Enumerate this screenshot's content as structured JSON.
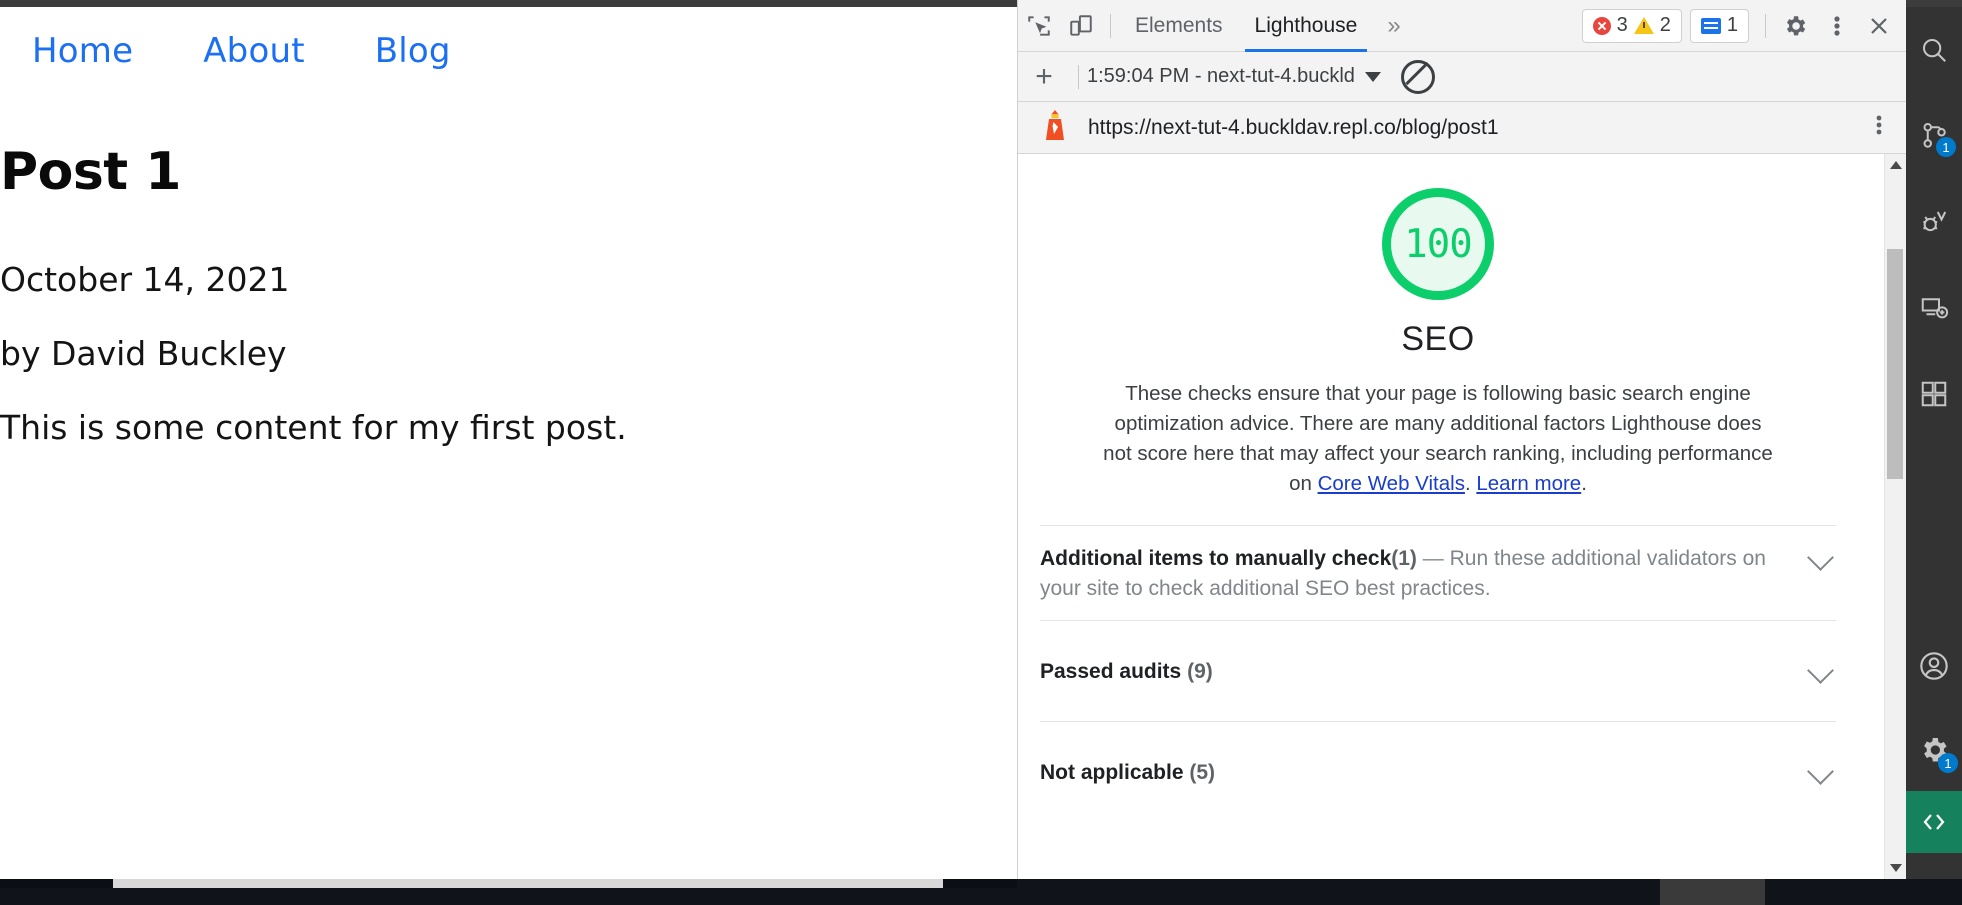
{
  "webpage": {
    "nav": [
      {
        "label": "Home",
        "icon": "nav-link"
      },
      {
        "label": "About",
        "icon": "nav-link"
      },
      {
        "label": "Blog",
        "icon": "nav-link"
      }
    ],
    "post": {
      "title": "Post 1",
      "date": "October 14, 2021",
      "byline": "by David Buckley",
      "body": "This is some content for my first post."
    }
  },
  "devtools": {
    "toolbar": {
      "inspect_icon": "inspect-element-icon",
      "device_icon": "device-toolbar-icon",
      "tabs": [
        {
          "label": "Elements",
          "active": false
        },
        {
          "label": "Lighthouse",
          "active": true
        }
      ],
      "more_tabs_label": "»",
      "errors": "3",
      "warnings": "2",
      "messages": "1",
      "settings_icon": "gear-icon",
      "menu_icon": "kebab-menu-icon",
      "close_icon": "close-icon",
      "error_color": "#e8453c",
      "warning_color": "#f5c518",
      "message_color": "#1a73e8",
      "active_tab_color": "#1a73e8"
    },
    "report_row": {
      "add_label": "+",
      "selected_report": "1:59:04 PM - next-tut-4.buckld",
      "dropdown_icon": "chevron-down-icon",
      "clear_icon": "no-entry-icon"
    },
    "url_row": {
      "favicon": "lighthouse-icon",
      "url": "https://next-tut-4.buckldav.repl.co/blog/post1",
      "menu_icon": "kebab-menu-icon"
    },
    "report": {
      "score": "100",
      "score_color": "#0cce6b",
      "category": "SEO",
      "description_part1": "These checks ensure that your page is following basic search engine optimization advice. There are many additional factors Lighthouse does not score here that may affect your search ranking, including performance on ",
      "link1": "Core Web Vitals",
      "description_mid": ". ",
      "link2": "Learn more",
      "description_end": ".",
      "groups": [
        {
          "title": "Additional items to manually check",
          "count": "(1)",
          "dash": " — ",
          "description": "Run these additional validators on your site to check additional SEO best practices.",
          "chevron": "chevron-down-icon"
        },
        {
          "title": "Passed audits",
          "count": "(9)",
          "dash": "",
          "description": "",
          "chevron": "chevron-down-icon"
        },
        {
          "title": "Not applicable",
          "count": "(5)",
          "dash": "",
          "description": "",
          "chevron": "chevron-down-icon"
        }
      ]
    },
    "scrollbar": {
      "up_icon": "scroll-up-arrow-icon",
      "down_icon": "scroll-down-arrow-icon"
    }
  },
  "activity_bar": {
    "items": [
      {
        "icon": "search-icon",
        "badge": ""
      },
      {
        "icon": "source-control-icon",
        "badge": "1"
      },
      {
        "icon": "run-and-debug-icon",
        "badge": ""
      },
      {
        "icon": "remote-explorer-icon",
        "badge": ""
      },
      {
        "icon": "extensions-icon",
        "badge": ""
      }
    ],
    "bottom_items": [
      {
        "icon": "account-icon",
        "badge": ""
      },
      {
        "icon": "settings-gear-icon",
        "badge": "1"
      }
    ],
    "remote_icon": "remote-window-icon",
    "remote_color": "#16825d"
  }
}
